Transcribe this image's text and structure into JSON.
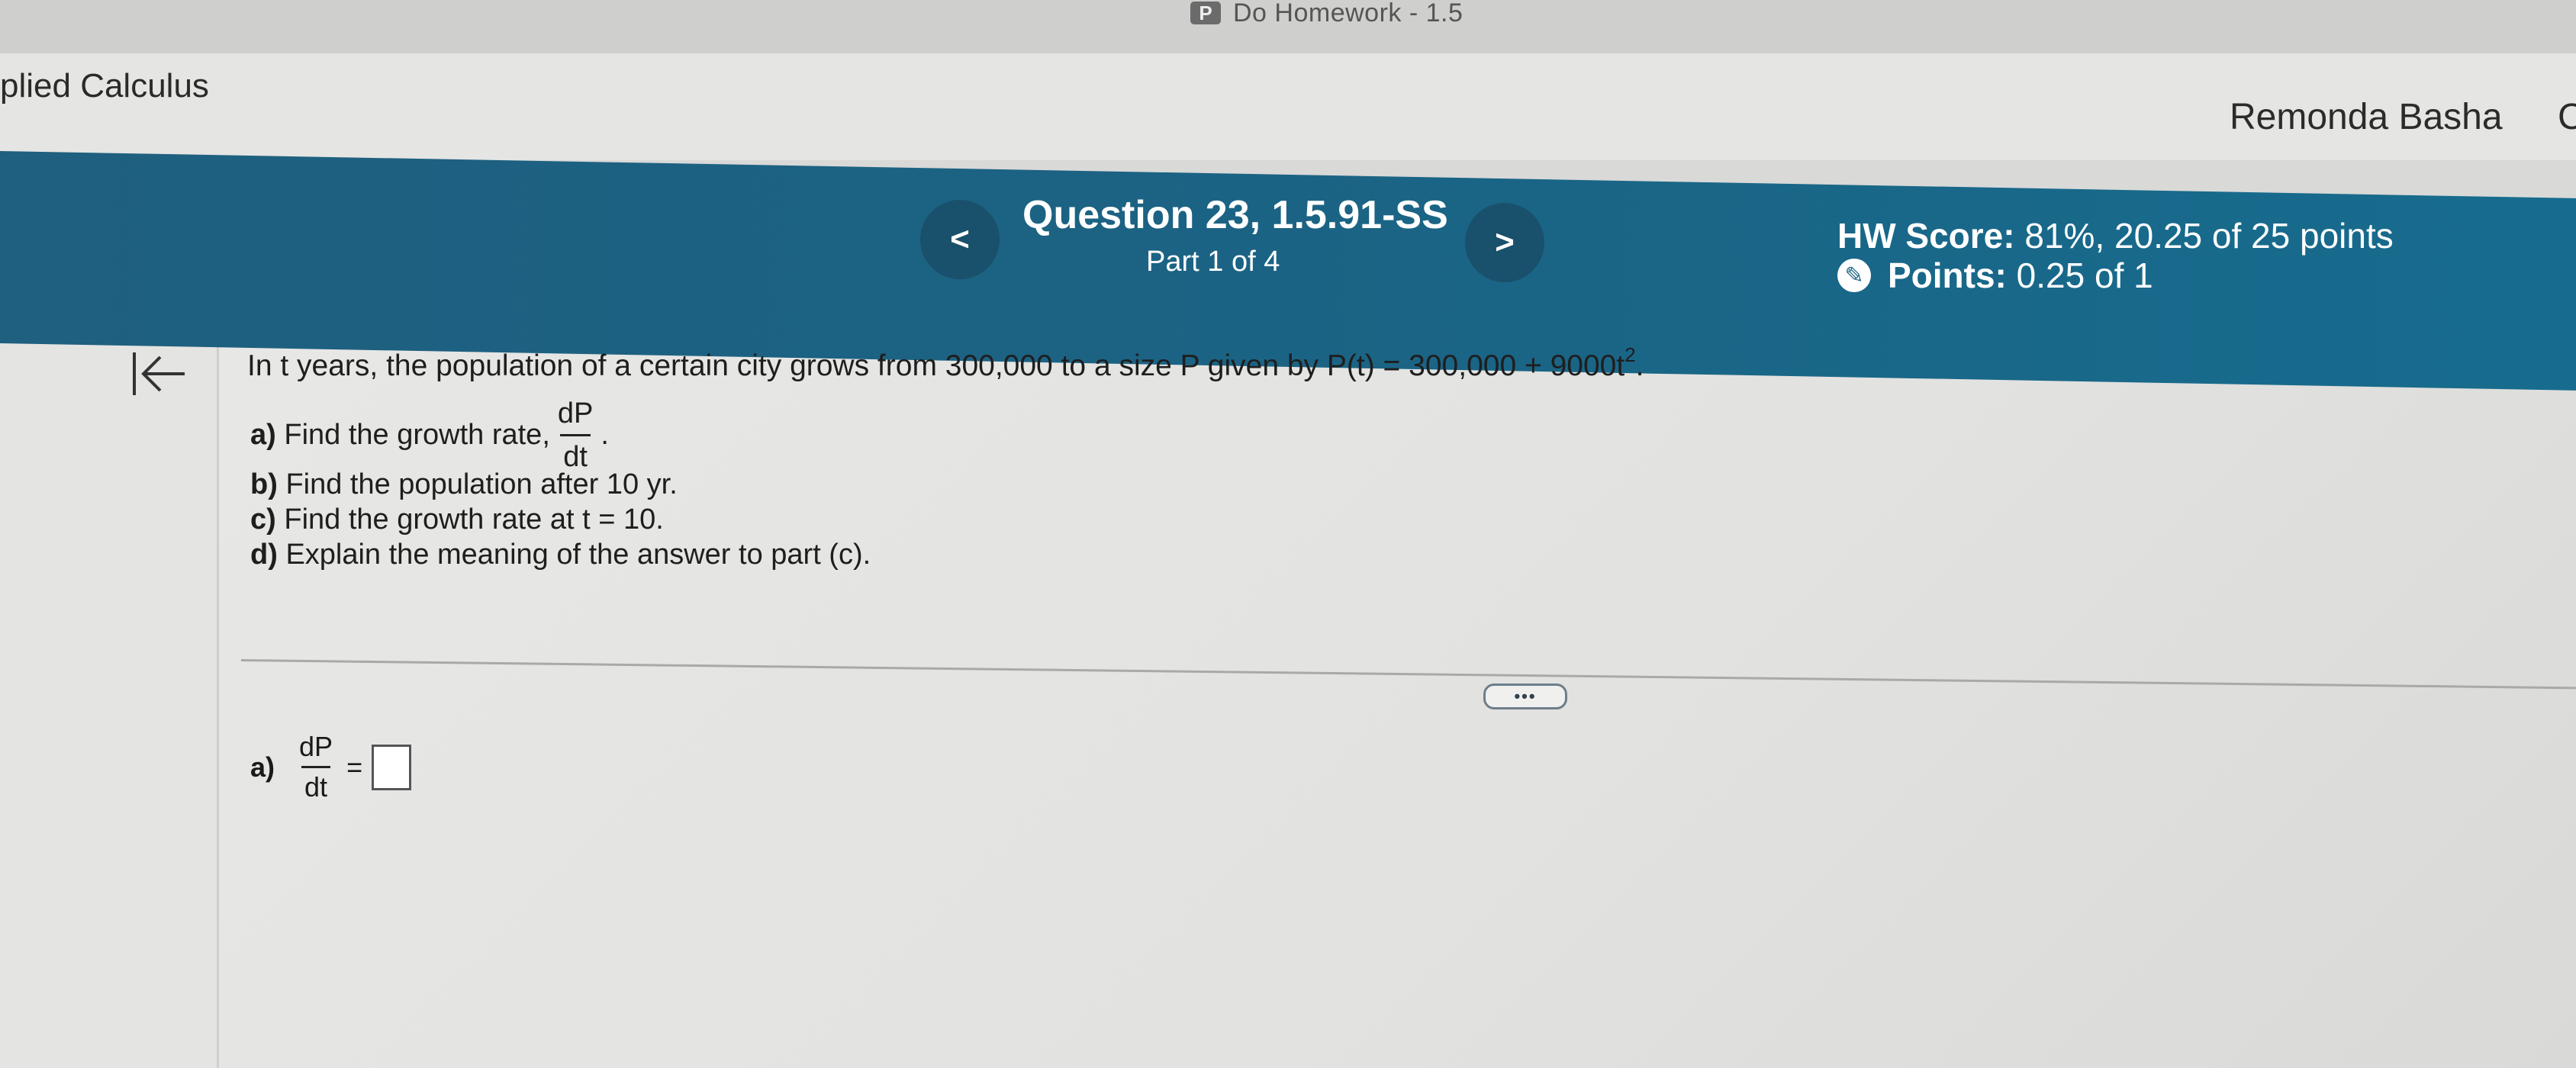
{
  "tab": {
    "favicon_letter": "P",
    "title": "Do Homework - 1.5"
  },
  "course": {
    "title": "plied Calculus",
    "user_name": "Remonda Basha",
    "user_extra": "C"
  },
  "question_header": {
    "prev_symbol": "<",
    "next_symbol": ">",
    "title": "Question 23, 1.5.91-SS",
    "part": "Part 1 of 4",
    "hw_score_label": "HW Score:",
    "hw_score_value": "81%, 20.25 of 25 points",
    "points_label": "Points:",
    "points_value": "0.25 of 1"
  },
  "problem": {
    "intro_text": "In t years, the population of a certain city grows from 300,000 to a size P given by P(t) = 300,000 + 9000t",
    "intro_exponent": "2",
    "intro_end": ".",
    "parts": {
      "a_label": "a)",
      "a_text": "Find the growth rate,",
      "a_frac_num": "dP",
      "a_frac_den": "dt",
      "a_end": ".",
      "b_label": "b)",
      "b_text": "Find the population after 10 yr.",
      "c_label": "c)",
      "c_text": "Find the growth rate at t = 10.",
      "d_label": "d)",
      "d_text": "Explain the meaning of the answer to part (c)."
    }
  },
  "more_button": "•••",
  "answer": {
    "label": "a)",
    "frac_num": "dP",
    "frac_den": "dt",
    "equals": "="
  }
}
